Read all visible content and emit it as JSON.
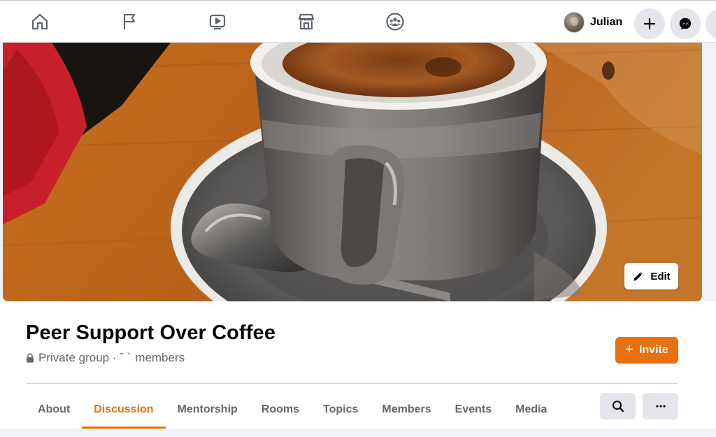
{
  "topbar": {
    "nav_icons": [
      "home-icon",
      "pages-flag-icon",
      "watch-video-icon",
      "marketplace-icon",
      "groups-icon"
    ],
    "profile": {
      "name": "Julian"
    },
    "actions": [
      "create-plus-icon",
      "messenger-icon"
    ]
  },
  "cover": {
    "edit_label": "Edit"
  },
  "group": {
    "title": "Peer Support Over Coffee",
    "privacy": "Private group",
    "separator": " · ",
    "member_count": "ˆ ˋ",
    "members_suffix": "members",
    "invite_label": "Invite"
  },
  "tabs": [
    {
      "label": "About"
    },
    {
      "label": "Discussion",
      "active": true
    },
    {
      "label": "Mentorship"
    },
    {
      "label": "Rooms"
    },
    {
      "label": "Topics"
    },
    {
      "label": "Members"
    },
    {
      "label": "Events"
    },
    {
      "label": "Media"
    }
  ],
  "colors": {
    "accent": "#e8700f",
    "secondary_text": "#65676b",
    "button_gray": "#e4e6eb"
  }
}
